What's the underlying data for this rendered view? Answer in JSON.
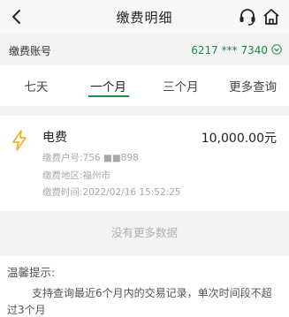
{
  "header": {
    "title": "缴费明细",
    "back_icon": "chevron-left-icon",
    "service_icon": "headset-icon",
    "home_icon": "home-icon"
  },
  "account": {
    "label": "缴费账号",
    "value": "6217 *** 7340"
  },
  "tabs": [
    {
      "label": "七天",
      "active": false
    },
    {
      "label": "一个月",
      "active": true
    },
    {
      "label": "三个月",
      "active": false
    },
    {
      "label": "更多查询",
      "active": false
    }
  ],
  "record": {
    "icon": "lightning-bolt-icon",
    "name": "电费",
    "amount": "10,000.00元",
    "account_no": "缴费户号:756 ■■898",
    "area": "缴费地区:福州市",
    "time": "缴费时间:2022/02/16 15:52:25"
  },
  "no_more": "没有更多数据",
  "tips": {
    "title": "温馨提示:",
    "text": "支持查询最近6个月内的交易记录，单次时间段不超过3个月"
  },
  "colors": {
    "accent": "#1f8a4f",
    "bolt": "#f2b424"
  }
}
